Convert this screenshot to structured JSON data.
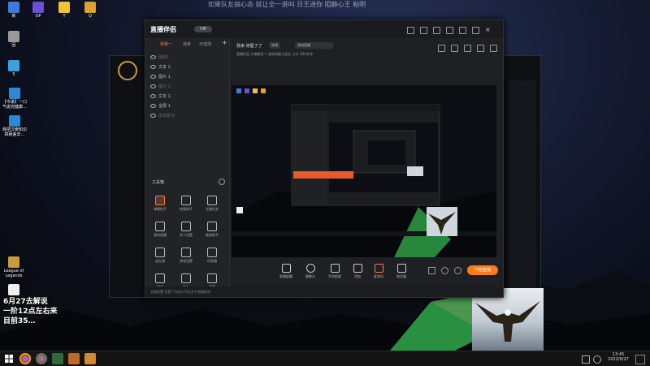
{
  "watermark": "如果队友搞心态 就让全一进叫 日王迷你 阻静心王 粘明",
  "desktop_icons": [
    {
      "label": "新",
      "color": "#3d7bd9"
    },
    {
      "label": "OP",
      "color": "#6b4fd8"
    },
    {
      "label": "Y",
      "color": "#f2c230"
    },
    {
      "label": "Q",
      "color": "#e0a030"
    },
    {
      "label": "回",
      "color": "#999999"
    },
    {
      "label": "5",
      "color": "#3aa0e0"
    },
    {
      "label": "【今歌】一口气说完健康…",
      "color": "#2a89d8"
    },
    {
      "label": "我把汉索知识搞砸差去…",
      "color": "#2a89d8"
    },
    {
      "label": "League of Legends",
      "color": "#c89b3c"
    },
    {
      "label": "",
      "color": "#eeeeee"
    }
  ],
  "overlay_text": {
    "line1": "6月27去解说",
    "line2": "一阶12点左右来",
    "line3": "目前35…"
  },
  "app": {
    "title": "直播伴侣",
    "vip": "VIP",
    "tabs": [
      "场景一",
      "场景",
      "可选场"
    ],
    "scenes": [
      {
        "name": "图像1",
        "dim": true
      },
      {
        "name": "文本 2",
        "dim": false
      },
      {
        "name": "图片 1",
        "dim": false
      },
      {
        "name": "图片 1",
        "dim": true
      },
      {
        "name": "文本 1",
        "dim": false
      },
      {
        "name": "全屏 1",
        "dim": false
      },
      {
        "name": "添加素材",
        "dim": true
      }
    ],
    "toolbox_label": "工具箱",
    "tools": [
      "弹幕助手",
      "房管助手",
      "主播任务",
      "我的直播",
      "发人设置",
      "维修助手",
      "送礼物",
      "游戏设置",
      "评直播",
      "游戏",
      "快乐",
      "直播"
    ],
    "header": {
      "room_title": "我来 修图了了",
      "tag1": "修改",
      "tag2": "游戏直播",
      "sub": "直播标签  大神解说 ✎   游戏讲解大会社 小分  1DG完毕"
    },
    "bottom_bar": [
      "直播屏幕",
      "摄像头",
      "手机投屏",
      "添加",
      "麦克风",
      "扬声器"
    ],
    "go_live": "开始直播",
    "status": "礼物设置  设置了分成方开启当中,数据同步"
  },
  "taskbar": {
    "time": "13:45",
    "date": "2022/6/27"
  }
}
